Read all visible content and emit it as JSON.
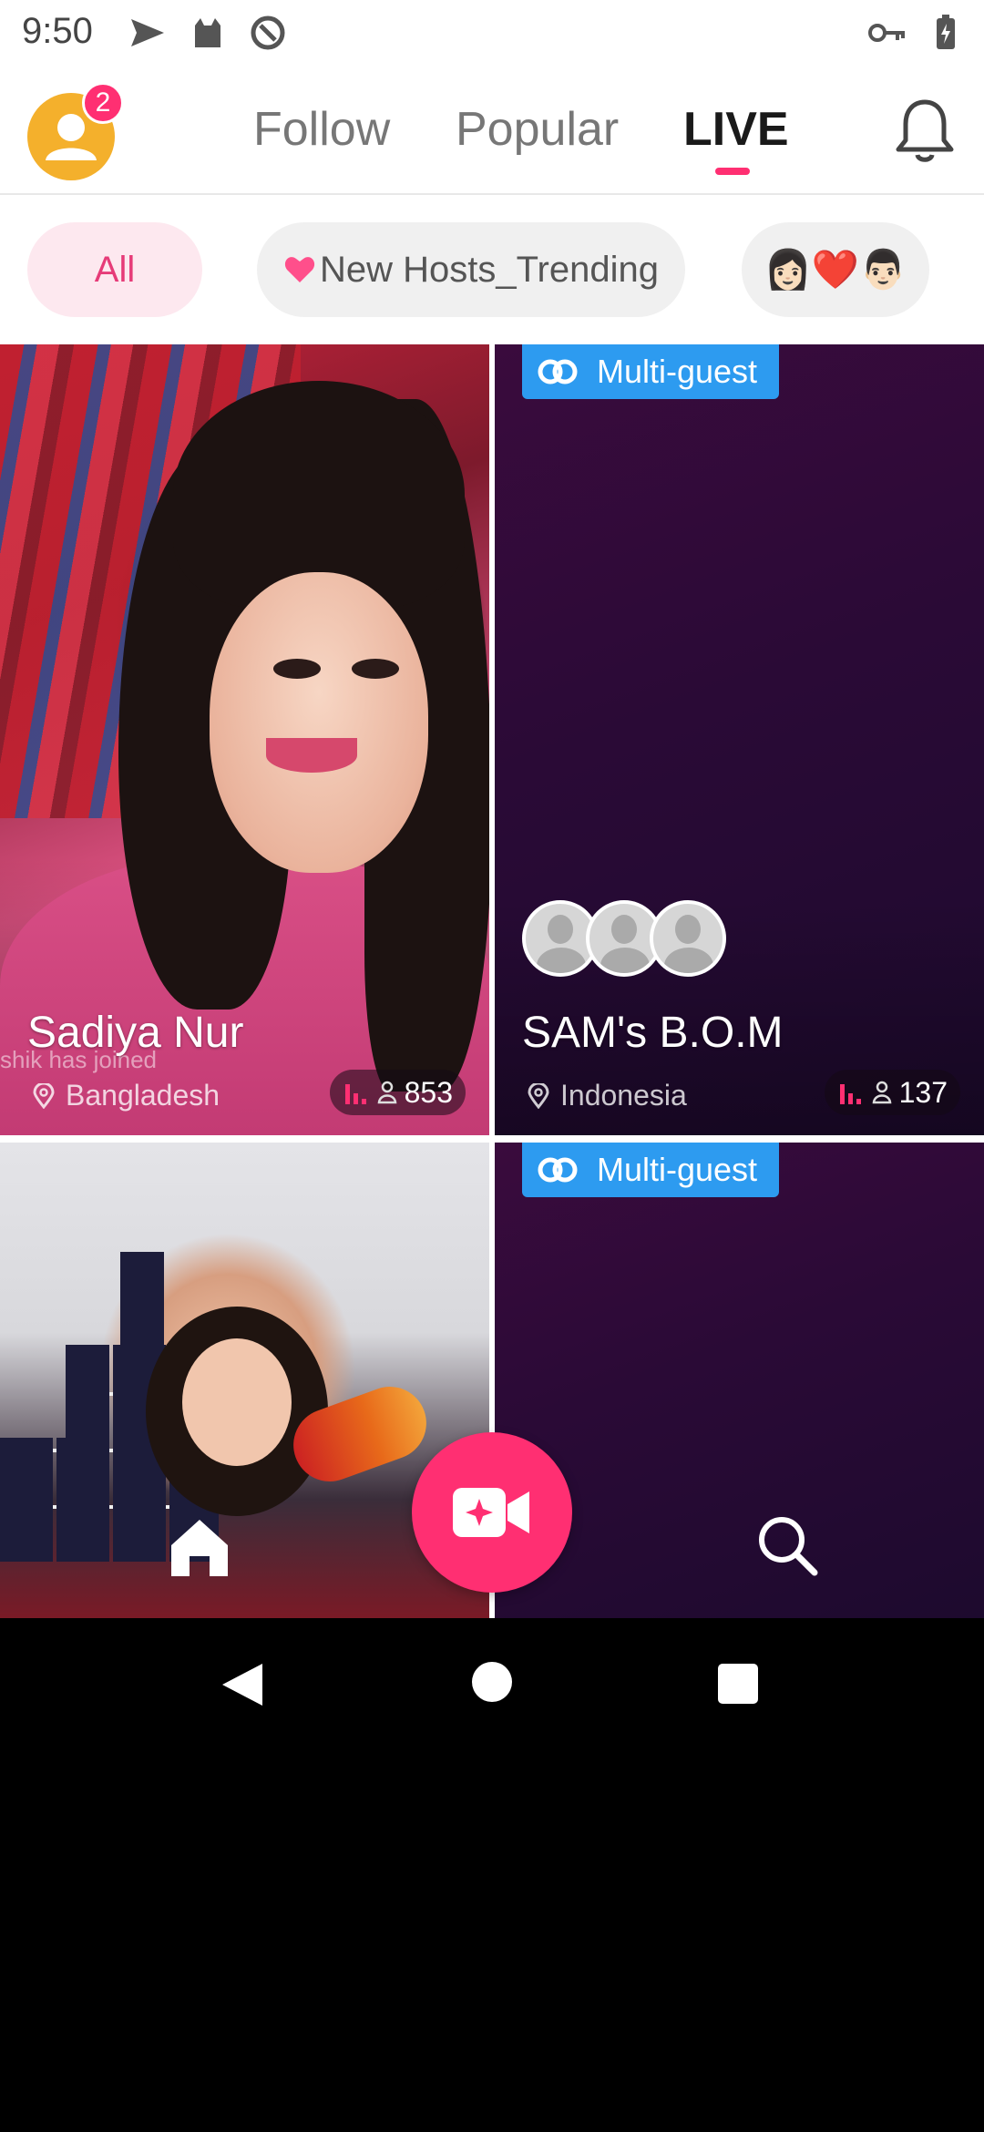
{
  "status_bar": {
    "time": "9:50",
    "left_icons": [
      "send-icon",
      "cat-icon",
      "at-sign-icon"
    ],
    "right_icons": [
      "key-icon",
      "battery-charging-icon"
    ]
  },
  "header": {
    "notification_count": "2",
    "tabs": [
      {
        "label": "Follow",
        "active": false
      },
      {
        "label": "Popular",
        "active": false
      },
      {
        "label": "LIVE",
        "active": true
      }
    ],
    "accent_color": "#ff2f72"
  },
  "filters": {
    "chips": [
      {
        "label": "All",
        "active": true
      },
      {
        "label": "New Hosts_Trending",
        "icon": "heart-icon",
        "active": false
      },
      {
        "label": "👩🏻❤️👨🏻",
        "active": false
      }
    ]
  },
  "streams": [
    {
      "name": "Sadiya Nur",
      "location": "Bangladesh",
      "viewers": "853",
      "overlay_text": "shik has joined",
      "multi_guest": false
    },
    {
      "name": "SAM's B.O.M",
      "location": "Indonesia",
      "viewers": "137",
      "badge": "Multi-guest",
      "multi_guest": true,
      "guest_count": 3
    },
    {
      "name": "",
      "multi_guest": false
    },
    {
      "name": "",
      "badge": "Multi-guest",
      "multi_guest": true
    }
  ],
  "bottom_nav": {
    "items": [
      "home-icon",
      "go-live-icon",
      "search-icon"
    ]
  },
  "colors": {
    "multi_guest_badge": "#2d9bf0",
    "chip_active_bg": "#fde8ef",
    "chip_active_text": "#e63b78"
  }
}
